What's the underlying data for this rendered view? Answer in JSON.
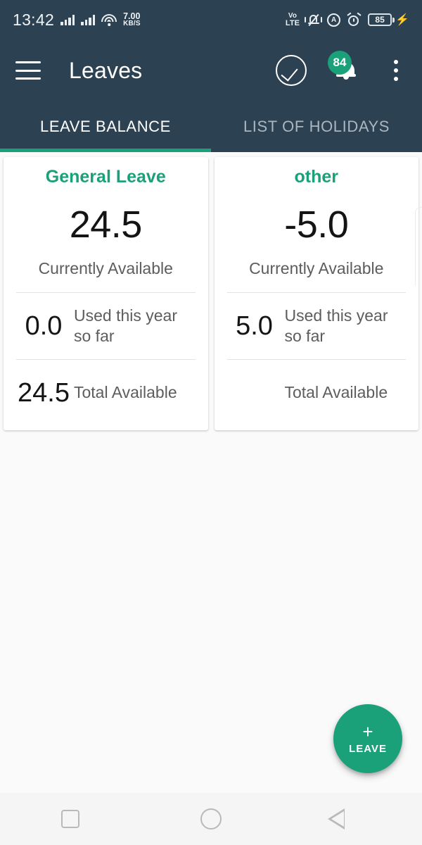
{
  "statusbar": {
    "time": "13:42",
    "net_speed_value": "7.00",
    "net_speed_unit": "KB/S",
    "volte_top": "Vo",
    "volte_bottom": "LTE",
    "battery_level": "85",
    "icons": [
      "signal-bars-icon",
      "signal-bars-icon",
      "wifi-icon",
      "volte-icon",
      "vibrate-mute-icon",
      "ring-mode-icon",
      "alarm-icon",
      "battery-icon",
      "charging-bolt-icon"
    ]
  },
  "appbar": {
    "title": "Leaves",
    "menu_icon": "hamburger-menu-icon",
    "approve_icon": "check-circle-icon",
    "notification_icon": "bell-icon",
    "notification_badge": "84",
    "overflow_icon": "kebab-menu-icon"
  },
  "tabs": {
    "items": [
      {
        "label": "LEAVE BALANCE",
        "active": true
      },
      {
        "label": "LIST OF HOLIDAYS",
        "active": false
      }
    ]
  },
  "colors": {
    "accent_green": "#1aa179",
    "appbar_dark": "#2c4151",
    "page_background": "#fafafa",
    "card_background": "#ffffff"
  },
  "leave_cards": [
    {
      "title": "General Leave",
      "current_value": "24.5",
      "current_label": "Currently Available",
      "used_value": "0.0",
      "used_label": "Used this year so far",
      "total_value": "24.5",
      "total_label": "Total Available"
    },
    {
      "title": "other",
      "current_value": "-5.0",
      "current_label": "Currently Available",
      "used_value": "5.0",
      "used_label": "Used this year so far",
      "total_value": "",
      "total_label": "Total Available"
    }
  ],
  "fab": {
    "plus": "+",
    "label": "LEAVE"
  },
  "navbar": {
    "recents_icon": "square-recents-icon",
    "home_icon": "circle-home-icon",
    "back_icon": "triangle-back-icon"
  }
}
